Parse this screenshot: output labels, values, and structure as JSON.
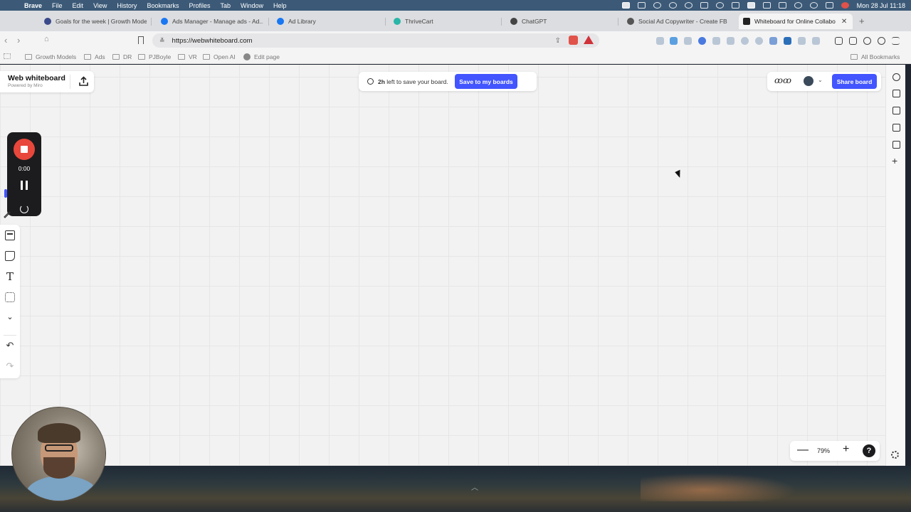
{
  "menubar": {
    "app": "Brave",
    "items": [
      "File",
      "Edit",
      "View",
      "History",
      "Bookmarks",
      "Profiles",
      "Tab",
      "Window",
      "Help"
    ],
    "clock": "Mon 28 Jul  11:18"
  },
  "tabs": [
    {
      "label": "Goals for the week | Growth Mode",
      "favicon_color": "#3a4a8a"
    },
    {
      "label": "Ads Manager - Manage ads - Ad...",
      "favicon_color": "#1877f2"
    },
    {
      "label": "Ad Library",
      "favicon_color": "#1877f2"
    },
    {
      "label": "ThriveCart",
      "favicon_color": "#29b5a8"
    },
    {
      "label": "ChatGPT",
      "favicon_color": "#444444"
    },
    {
      "label": "Social Ad Copywriter - Create FB",
      "favicon_color": "#555555"
    },
    {
      "label": "Whiteboard for Online Collabo",
      "favicon_color": "#222222",
      "active": true
    }
  ],
  "address_bar": {
    "url": "https://webwhiteboard.com"
  },
  "bookmarks": {
    "items": [
      "Growth Models",
      "Ads",
      "DR",
      "PJBoyle",
      "VR",
      "Open AI",
      "Edit page"
    ],
    "all_bookmarks": "All Bookmarks"
  },
  "board": {
    "brand_title": "Web whiteboard",
    "brand_subtitle": "Powered by Miro",
    "save_notice_bold": "2h",
    "save_notice_rest": " left to save your board.",
    "save_button": "Save to my boards",
    "share_button": "Share board",
    "signature": "ꝏꝏ"
  },
  "recorder": {
    "time": "0:00"
  },
  "zoom": {
    "level": "79%",
    "minus": "—",
    "plus": "+",
    "help": "?"
  },
  "colors": {
    "accent": "#4255ff",
    "record": "#e8473b"
  }
}
